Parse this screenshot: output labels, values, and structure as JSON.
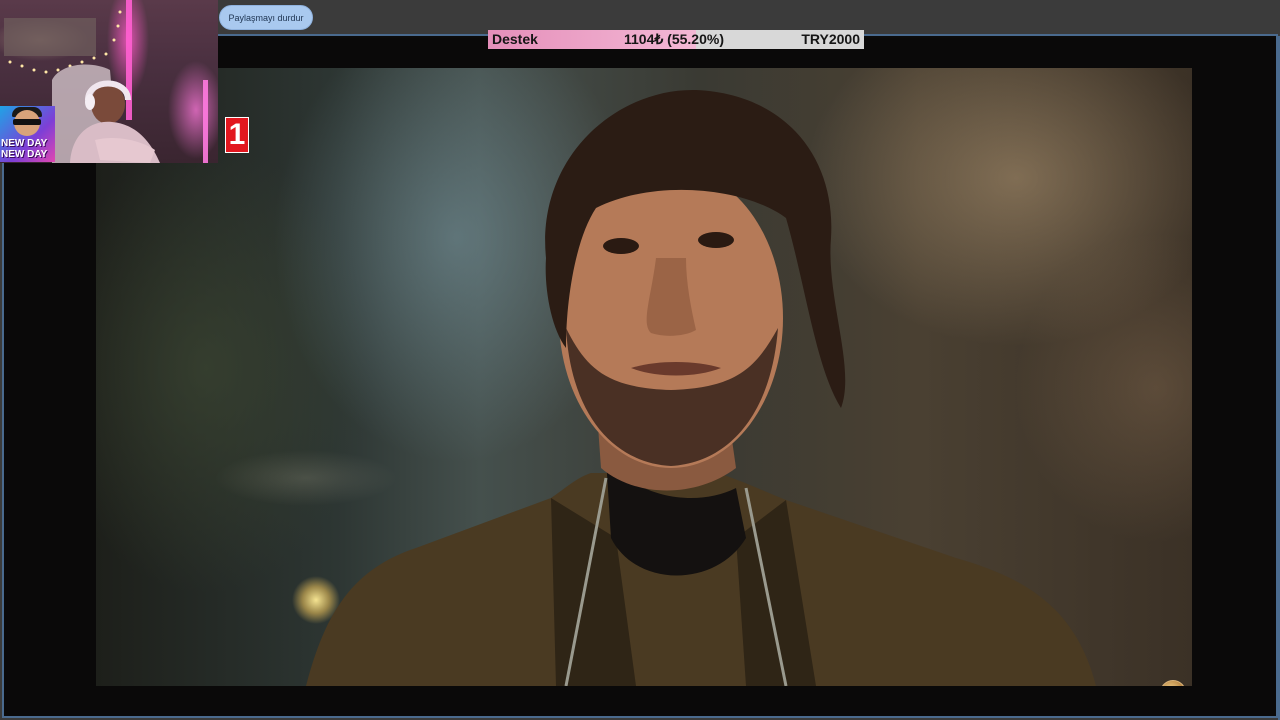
{
  "share": {
    "stop_label": "Paylaşmayı durdur"
  },
  "donation": {
    "label": "Destek",
    "amount": "1104₺ (55.20%)",
    "goal": "TRY2000",
    "progress_percent": 55.2,
    "fill_color": "#e58fba",
    "track_color": "#d8d8d8"
  },
  "webcam_sticker": {
    "line1": "NEW DAY",
    "line2": "NEW DAY"
  },
  "channel_badge": {
    "text": "1",
    "color": "#e2171f"
  },
  "colors": {
    "frame_border": "#4a6a8e",
    "button_bg": "#a9c9ef"
  }
}
